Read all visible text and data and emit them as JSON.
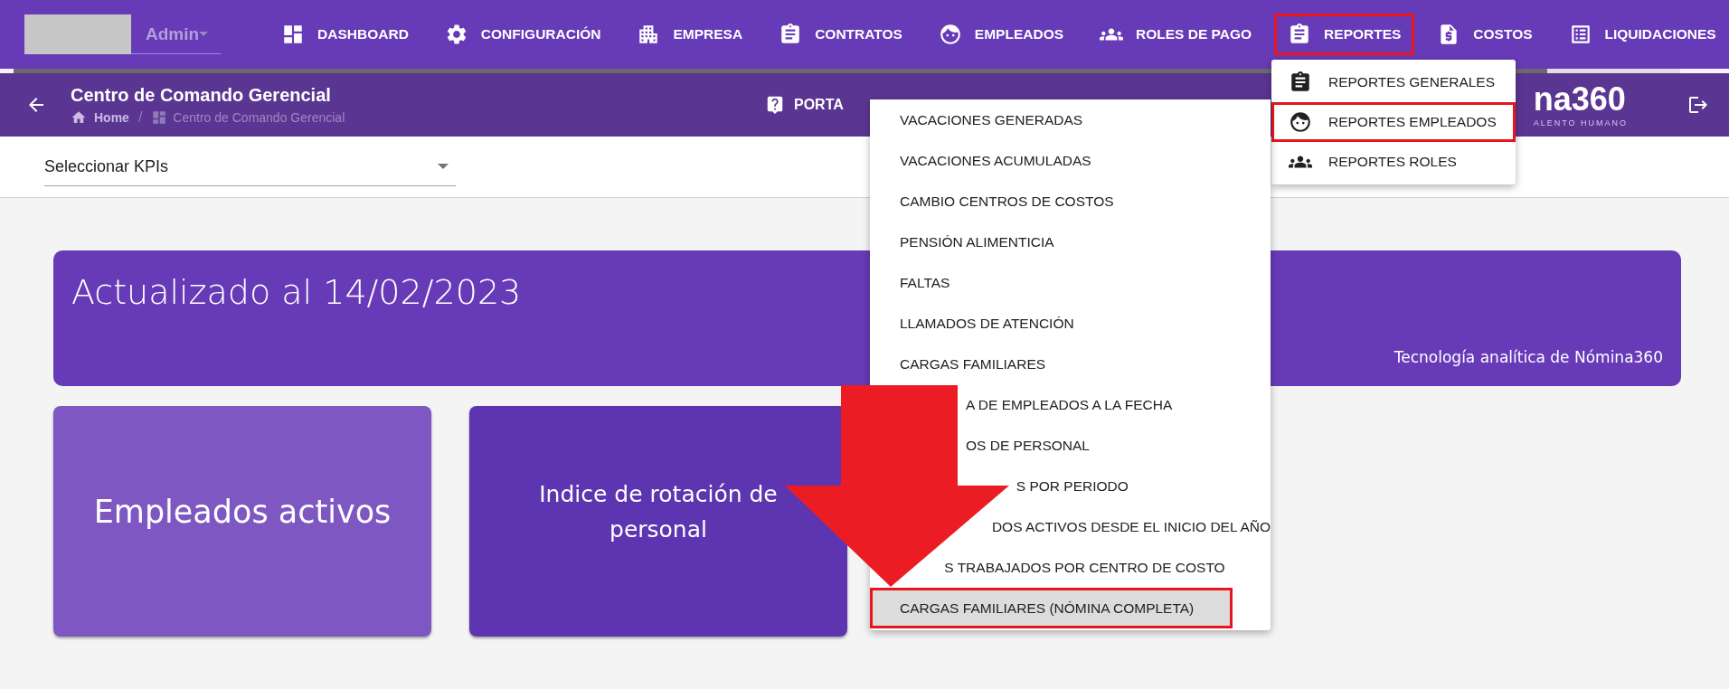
{
  "user_menu": {
    "value": "Admin"
  },
  "nav": [
    {
      "label": "DASHBOARD",
      "highlighted": false
    },
    {
      "label": "CONFIGURACIÓN",
      "highlighted": false
    },
    {
      "label": "EMPRESA",
      "highlighted": false
    },
    {
      "label": "CONTRATOS",
      "highlighted": false
    },
    {
      "label": "EMPLEADOS",
      "highlighted": false
    },
    {
      "label": "ROLES DE PAGO",
      "highlighted": false
    },
    {
      "label": "REPORTES",
      "highlighted": true
    },
    {
      "label": "COSTOS",
      "highlighted": false
    },
    {
      "label": "LIQUIDACIONES",
      "highlighted": false
    }
  ],
  "loading_bar": {
    "level": 0.92
  },
  "header": {
    "title": "Centro de Comando Gerencial",
    "breadcrumb": [
      "Home",
      "Centro de Comando Gerencial"
    ],
    "breadcrumb_separator": "/",
    "portal_label": "PORTA",
    "logo_text": "na360",
    "logo_tagline": "ALENTO HUMANO"
  },
  "kpi_select": {
    "label": "Seleccionar KPIs"
  },
  "banner": {
    "title": "Actualizado al 14/02/2023",
    "footer": "Tecnología analítica de Nómina360"
  },
  "kpi_cards": [
    {
      "label": "Empleados activos",
      "kind": "large",
      "color": "#7e57c2"
    },
    {
      "label": "Indice de rotación de personal",
      "kind": "small",
      "color": "#5e35b1"
    }
  ],
  "reports_menu": [
    {
      "label": "REPORTES GENERALES",
      "highlighted": false
    },
    {
      "label": "REPORTES EMPLEADOS",
      "highlighted": true
    },
    {
      "label": "REPORTES ROLES",
      "highlighted": false
    }
  ],
  "employee_reports_menu": [
    {
      "label": "VACACIONES GENERADAS",
      "selected": false,
      "highlighted": false
    },
    {
      "label": "VACACIONES ACUMULADAS",
      "selected": false,
      "highlighted": false
    },
    {
      "label": "CAMBIO CENTROS DE COSTOS",
      "selected": false,
      "highlighted": false
    },
    {
      "label": "PENSIÓN ALIMENTICIA",
      "selected": false,
      "highlighted": false
    },
    {
      "label": "FALTAS",
      "selected": false,
      "highlighted": false
    },
    {
      "label": "LLAMADOS DE ATENCIÓN",
      "selected": false,
      "highlighted": false
    },
    {
      "label": "CARGAS FAMILIARES",
      "selected": false,
      "highlighted": false
    },
    {
      "label": "A DE EMPLEADOS A LA FECHA",
      "selected": false,
      "highlighted": false
    },
    {
      "label": "OS DE PERSONAL",
      "selected": false,
      "highlighted": false
    },
    {
      "label": "S POR PERIODO",
      "selected": false,
      "highlighted": false
    },
    {
      "label": "DOS ACTIVOS DESDE EL INICIO DEL AÑO",
      "selected": false,
      "highlighted": false
    },
    {
      "label": "S TRABAJADOS POR CENTRO DE COSTO",
      "selected": false,
      "highlighted": false
    },
    {
      "label": "CARGAS FAMILIARES (NÓMINA COMPLETA)",
      "selected": true,
      "highlighted": true
    }
  ]
}
